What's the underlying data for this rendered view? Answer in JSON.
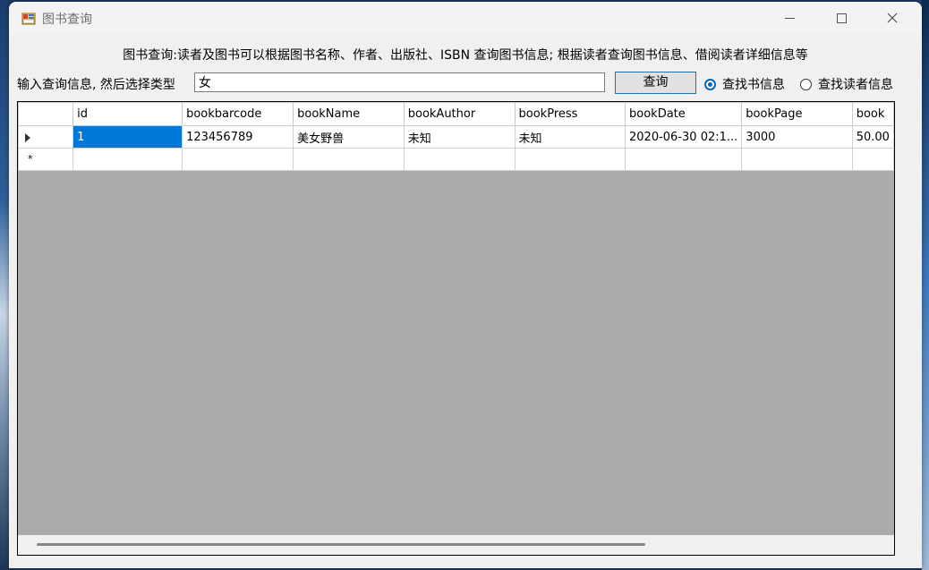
{
  "window": {
    "title": "图书查询"
  },
  "description": "图书查询:读者及图书可以根据图书名称、作者、出版社、ISBN 查询图书信息; 根据读者查询图书信息、借阅读者详细信息等",
  "search": {
    "label": "输入查询信息, 然后选择类型",
    "value": "女",
    "button_label": "查询"
  },
  "radios": [
    {
      "label": "查找书信息",
      "checked": true
    },
    {
      "label": "查找读者信息",
      "checked": false
    }
  ],
  "table": {
    "columns": [
      "id",
      "bookbarcode",
      "bookName",
      "bookAuthor",
      "bookPress",
      "bookDate",
      "bookPage",
      "book"
    ],
    "rows": [
      [
        "1",
        "123456789",
        "美女野兽",
        "未知",
        "未知",
        "2020-06-30 02:1...",
        "3000",
        "50.00"
      ]
    ]
  },
  "icons": {
    "app": "app-form-icon",
    "minimize": "minimize-icon",
    "maximize": "maximize-icon",
    "close": "close-icon",
    "current_row": "row-pointer-icon",
    "new_row": "new-row-icon"
  },
  "colors": {
    "selection": "#0078d7",
    "grid_background": "#ababab",
    "window_background": "#f0f0f0"
  }
}
